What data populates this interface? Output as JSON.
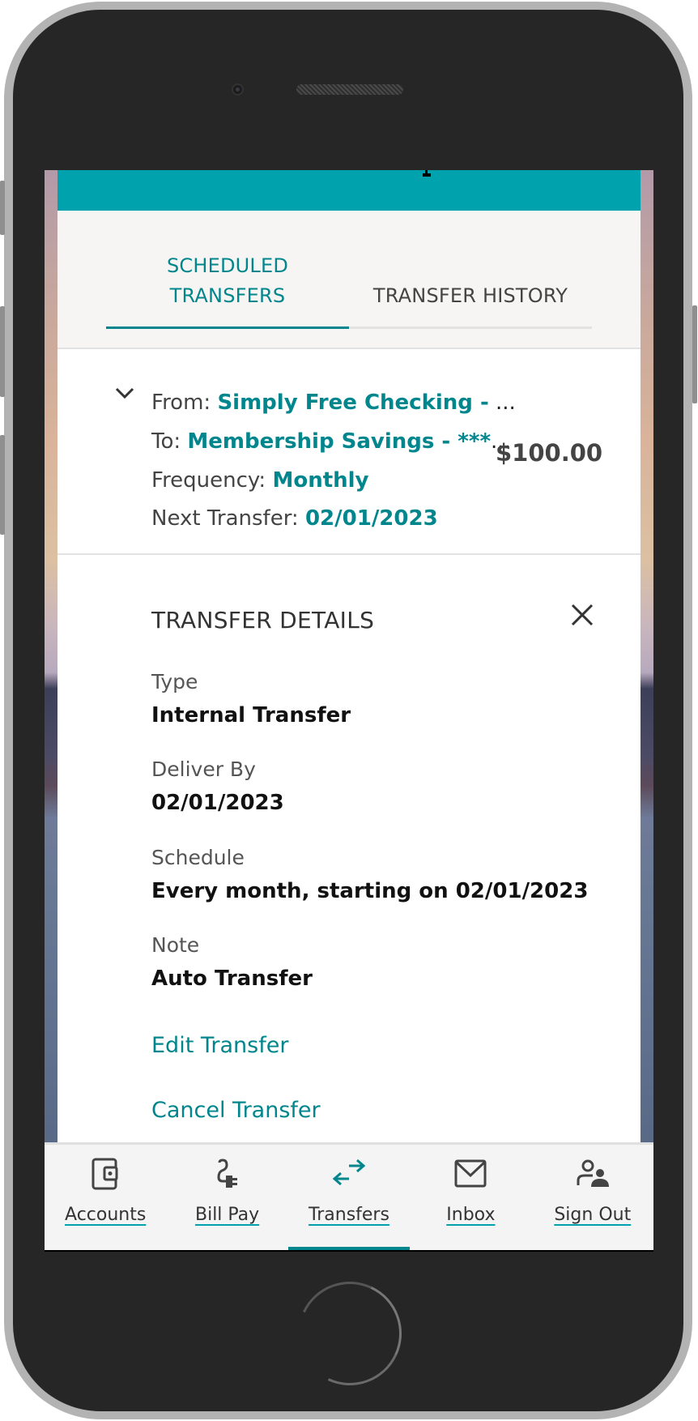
{
  "tabs": {
    "scheduled_line1": "SCHEDULED",
    "scheduled_line2": "TRANSFERS",
    "history": "TRANSFER HISTORY",
    "active": "scheduled"
  },
  "summary": {
    "from_label": "From:",
    "from_value": "Simply Free Checking -",
    "from_ellipsis": "...",
    "to_label": "To:",
    "to_value": "Membership Savings - ***",
    "to_ellipsis": "...",
    "frequency_label": "Frequency:",
    "frequency_value": "Monthly",
    "next_label": "Next Transfer:",
    "next_value": "02/01/2023",
    "amount": "$100.00",
    "expand_icon": "chevron-down-icon"
  },
  "details": {
    "title": "TRANSFER DETAILS",
    "close_icon": "close-icon",
    "fields": [
      {
        "label": "Type",
        "value": "Internal Transfer"
      },
      {
        "label": "Deliver By",
        "value": "02/01/2023"
      },
      {
        "label": "Schedule",
        "value": "Every month, starting on 02/01/2023"
      },
      {
        "label": "Note",
        "value": "Auto Transfer"
      }
    ],
    "edit_link": "Edit Transfer",
    "cancel_link": "Cancel Transfer"
  },
  "nav": {
    "items": [
      {
        "label": "Accounts",
        "icon": "wallet-icon"
      },
      {
        "label": "Bill Pay",
        "icon": "plug-icon"
      },
      {
        "label": "Transfers",
        "icon": "transfer-arrows-icon"
      },
      {
        "label": "Inbox",
        "icon": "envelope-icon"
      },
      {
        "label": "Sign Out",
        "icon": "user-group-icon"
      }
    ],
    "active": "Transfers"
  },
  "colors": {
    "brand_teal": "#00a3ad",
    "accent_teal": "#00868c",
    "text_dark": "#111111",
    "text_label": "#444444"
  }
}
